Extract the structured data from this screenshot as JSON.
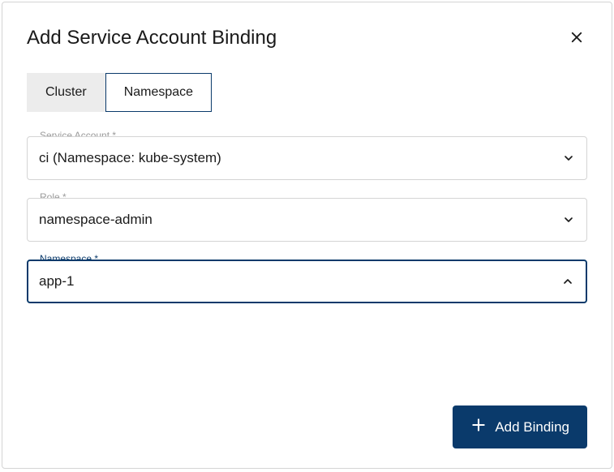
{
  "dialog": {
    "title": "Add Service Account Binding"
  },
  "tabs": {
    "cluster": "Cluster",
    "namespace": "Namespace"
  },
  "fields": {
    "serviceAccount": {
      "label": "Service Account",
      "required": "*",
      "value": "ci (Namespace: kube-system)"
    },
    "role": {
      "label": "Role",
      "required": "*",
      "value": "namespace-admin"
    },
    "namespace": {
      "label": "Namespace",
      "required": "*",
      "value": "app-1"
    }
  },
  "actions": {
    "addBinding": "Add Binding"
  }
}
